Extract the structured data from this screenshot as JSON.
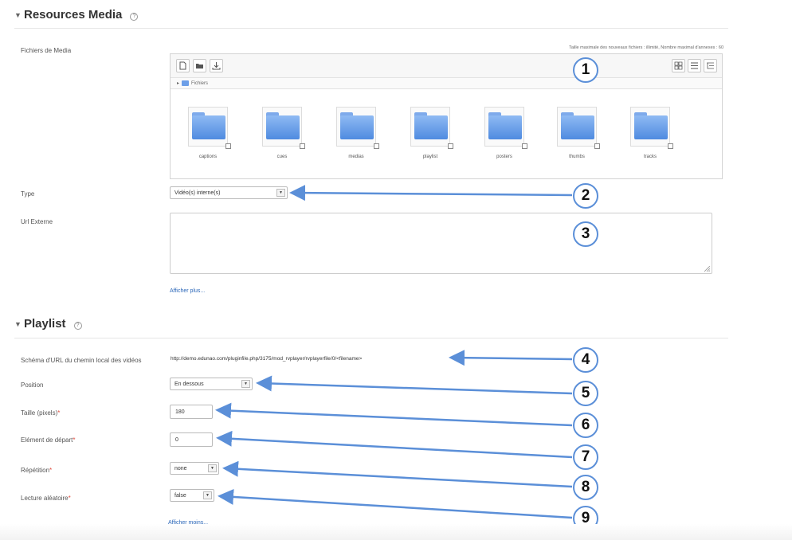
{
  "sections": {
    "resources": {
      "title": "Resources Media"
    },
    "playlist": {
      "title": "Playlist"
    }
  },
  "file_manager": {
    "label": "Fichiers de Media",
    "limits": "Taille maximale des nouveaux fichiers : illimité, Nombre maximal d'annexes : 60",
    "path_label": "Fichiers",
    "folders": [
      "captions",
      "cues",
      "medias",
      "playlist",
      "posters",
      "thumbs",
      "tracks"
    ]
  },
  "fields": {
    "type": {
      "label": "Type",
      "value": "Vidéo(s) interne(s)"
    },
    "url_externe": {
      "label": "Url Externe",
      "value": ""
    },
    "show_more": "Afficher plus...",
    "url_pattern": {
      "label": "Schéma d'URL du chemin local des vidéos",
      "value": "http://demo.edunao.com/pluginfile.php/3175/mod_rvplayer/rvplayerfile/0/<filename>"
    },
    "position": {
      "label": "Position",
      "value": "En dessous"
    },
    "taille": {
      "label": "Taille (pixels)",
      "value": "180"
    },
    "element_depart": {
      "label": "Elément de départ",
      "value": "0"
    },
    "repetition": {
      "label": "Répétition",
      "value": "none"
    },
    "lecture_aleatoire": {
      "label": "Lecture aléatoire",
      "value": "false"
    },
    "show_less": "Afficher moins..."
  },
  "callouts": [
    "1",
    "2",
    "3",
    "4",
    "5",
    "6",
    "7",
    "8",
    "9"
  ],
  "colors": {
    "callout": "#5b8fd8",
    "link": "#2a66b8",
    "required": "#e04a3d"
  }
}
